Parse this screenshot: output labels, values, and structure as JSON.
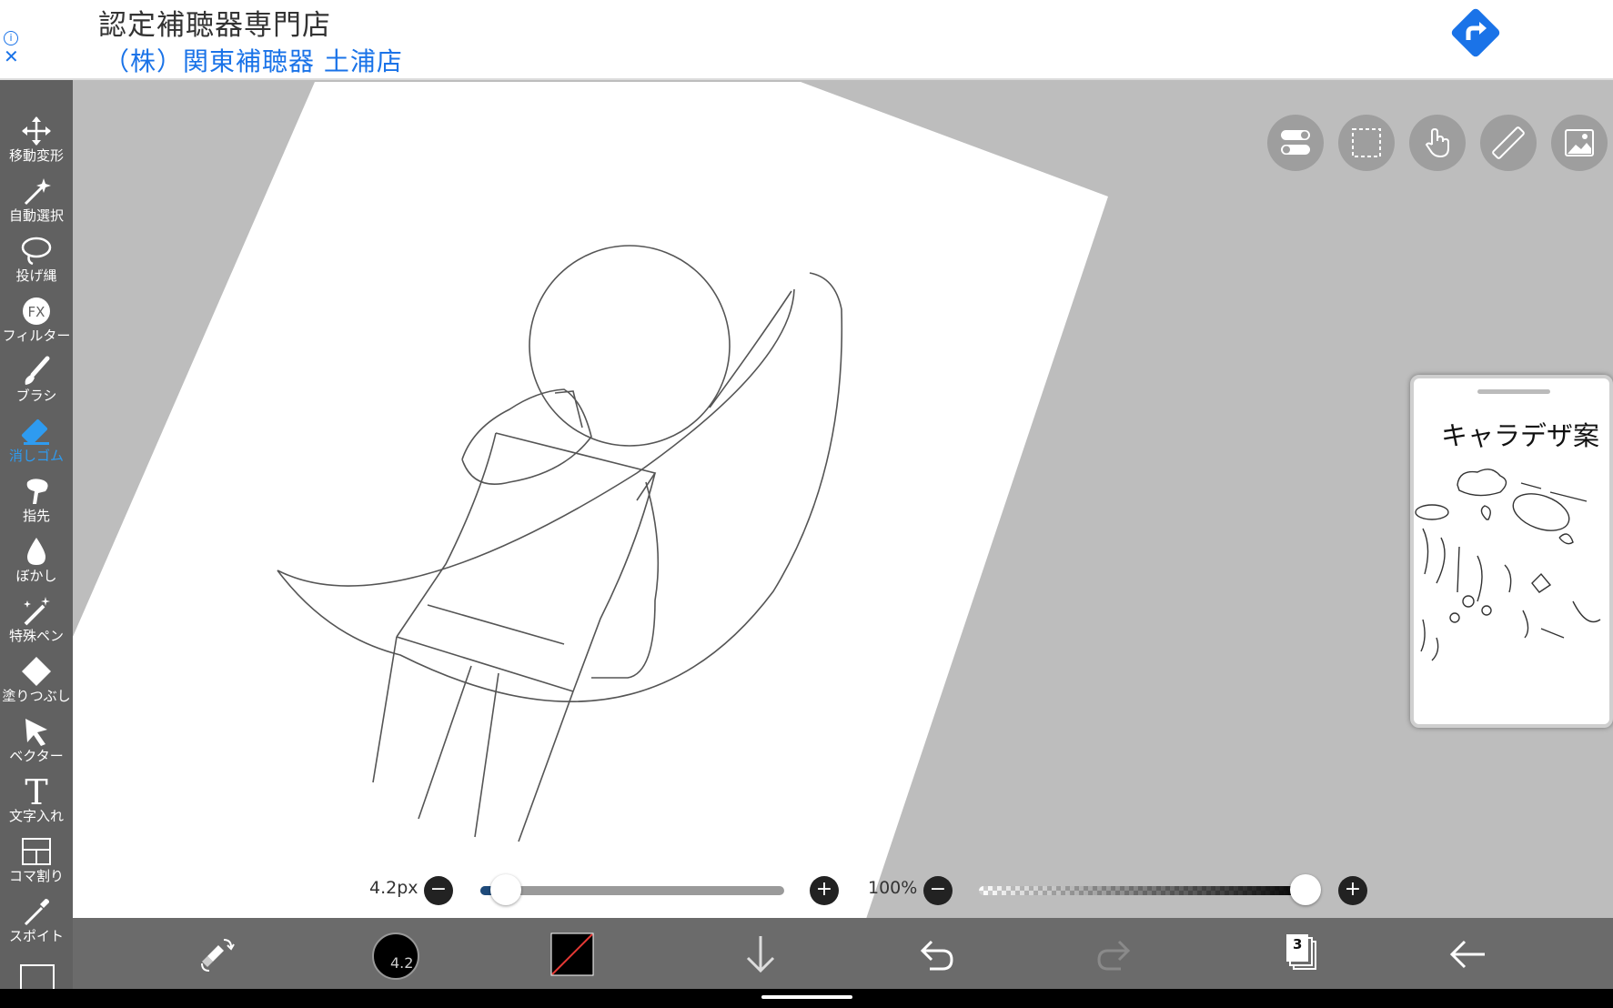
{
  "ad": {
    "title": "認定補聴器専門店",
    "subtitle": "（株）関東補聴器 土浦店",
    "info_icon": "info-icon",
    "close_icon": "close-icon",
    "action_icon": "directions-icon",
    "accent": "#1a73e8"
  },
  "tools": [
    {
      "label": "移動変形",
      "icon": "move-icon"
    },
    {
      "label": "自動選択",
      "icon": "magic-wand-icon"
    },
    {
      "label": "投げ縄",
      "icon": "lasso-icon"
    },
    {
      "label": "フィルター",
      "icon": "fx-icon"
    },
    {
      "label": "ブラシ",
      "icon": "brush-icon"
    },
    {
      "label": "消しゴム",
      "icon": "eraser-icon",
      "active": true
    },
    {
      "label": "指先",
      "icon": "finger-icon"
    },
    {
      "label": "ぼかし",
      "icon": "blur-drop-icon"
    },
    {
      "label": "特殊ペン",
      "icon": "special-pen-icon"
    },
    {
      "label": "塗りつぶし",
      "icon": "fill-bucket-icon"
    },
    {
      "label": "ベクター",
      "icon": "vector-icon"
    },
    {
      "label": "文字入れ",
      "icon": "text-icon"
    },
    {
      "label": "コマ割り",
      "icon": "frame-divider-icon"
    },
    {
      "label": "スポイト",
      "icon": "eyedropper-icon"
    }
  ],
  "top_buttons": [
    "toggle-icon",
    "selection-icon",
    "hand-icon",
    "ruler-icon",
    "image-icon"
  ],
  "brush_size": {
    "label": "4.2px",
    "value": 4.2,
    "fraction": 0.02
  },
  "opacity": {
    "label": "100%",
    "value": 100,
    "fraction": 1.0
  },
  "bottom_bar": {
    "brush_preview_value": "4.2",
    "layers_count": "3",
    "active_color": "#2e9bf0"
  },
  "reference_panel": {
    "title": "キャラデザ案"
  }
}
